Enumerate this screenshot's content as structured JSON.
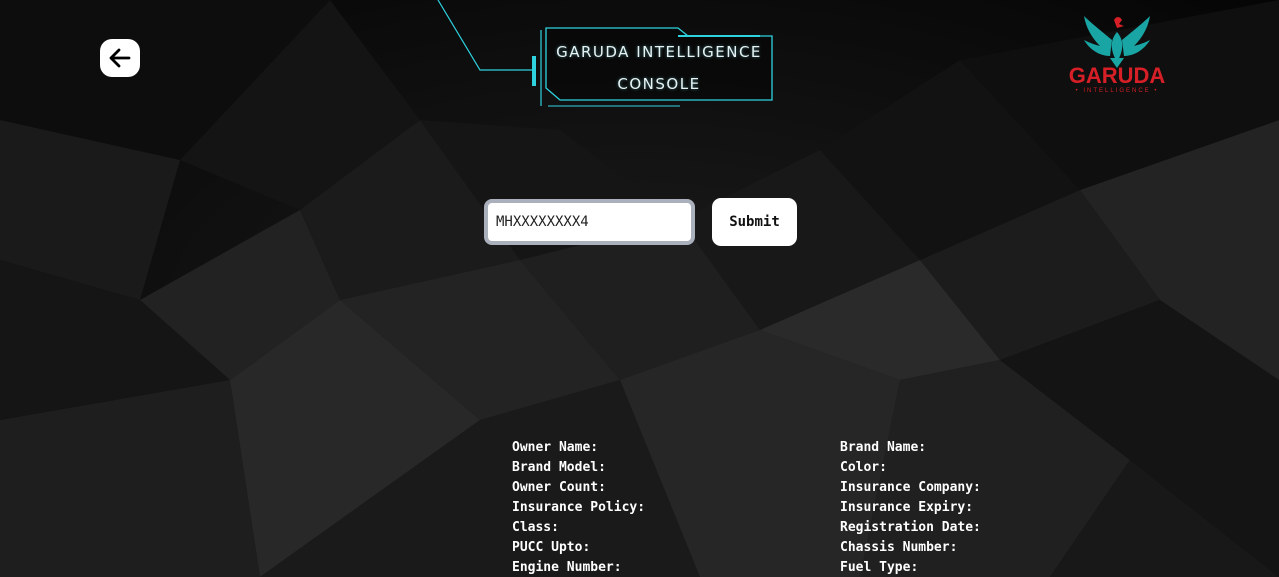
{
  "header": {
    "console_title_line1": "GARUDA INTELLIGENCE",
    "console_title_line2": "CONSOLE"
  },
  "logo": {
    "name": "GARUDA",
    "subtitle": "• INTELLIGENCE •",
    "brand_red": "#d61f26",
    "brand_teal": "#1aa5a5"
  },
  "back_button": {
    "icon": "arrow-left-icon"
  },
  "search": {
    "value": "MHXXXXXXXX4",
    "placeholder": ""
  },
  "submit_label": "Submit",
  "details": {
    "left": [
      "Owner Name:",
      "Brand Model:",
      "Owner Count:",
      "Insurance Policy:",
      "Class:",
      "PUCC Upto:",
      "Engine Number:"
    ],
    "right": [
      "Brand Name:",
      "Color:",
      "Insurance Company:",
      "Insurance Expiry:",
      "Registration Date:",
      "Chassis Number:",
      "Fuel Type:"
    ]
  },
  "colors": {
    "accent_cyan": "#2fd3e0",
    "background": "#0b0b0b"
  }
}
